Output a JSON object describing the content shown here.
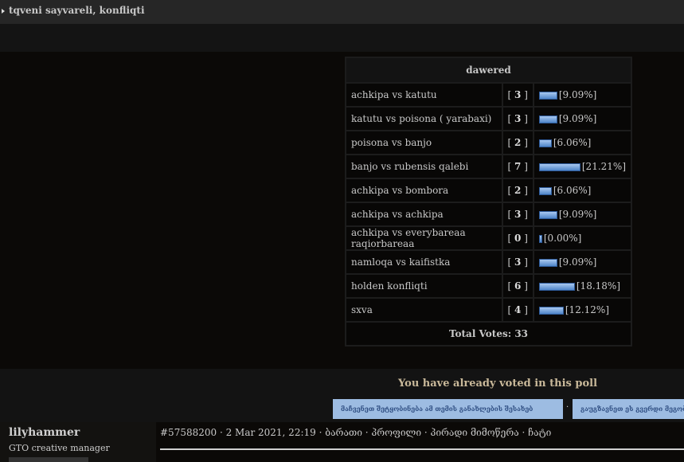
{
  "topic": {
    "title": "tqveni sayvareli, konfliqti"
  },
  "poll": {
    "header": "dawered",
    "options": [
      {
        "label": "achkipa vs katutu",
        "votes": "3",
        "percent": 9.09,
        "percent_label": "[9.09%]"
      },
      {
        "label": "katutu vs poisona ( yarabaxi)",
        "votes": "3",
        "percent": 9.09,
        "percent_label": "[9.09%]"
      },
      {
        "label": "poisona vs banjo",
        "votes": "2",
        "percent": 6.06,
        "percent_label": "[6.06%]"
      },
      {
        "label": "banjo vs rubensis qalebi",
        "votes": "7",
        "percent": 21.21,
        "percent_label": "[21.21%]"
      },
      {
        "label": "achkipa vs bombora",
        "votes": "2",
        "percent": 6.06,
        "percent_label": "[6.06%]"
      },
      {
        "label": "achkipa vs achkipa",
        "votes": "3",
        "percent": 9.09,
        "percent_label": "[9.09%]"
      },
      {
        "label": "achkipa vs everybareaa raqiorbareaa",
        "votes": "0",
        "percent": 0,
        "percent_label": "[0.00%]"
      },
      {
        "label": "namloqa vs kaifistka",
        "votes": "3",
        "percent": 9.09,
        "percent_label": "[9.09%]"
      },
      {
        "label": "holden konfliqti",
        "votes": "6",
        "percent": 18.18,
        "percent_label": "[18.18%]"
      },
      {
        "label": "sxva",
        "votes": "4",
        "percent": 12.12,
        "percent_label": "[12.12%]"
      }
    ],
    "total": "Total Votes: 33",
    "voted_message": "You have already voted in this poll"
  },
  "buttons": {
    "notify": "მაჩვენეთ შეტყობინება ამ თემის განახლების შესახებ",
    "send": "გაუგზავნეთ ეს გვერდი მეგობარს",
    "separator": "·"
  },
  "post": {
    "author": "lilyhammer",
    "role": "GTO creative manager",
    "meta": "#57588200 · 2 Mar 2021, 22:19 · ბარათი · პროფილი · პირადი მიმოწერა · ჩატი"
  }
}
